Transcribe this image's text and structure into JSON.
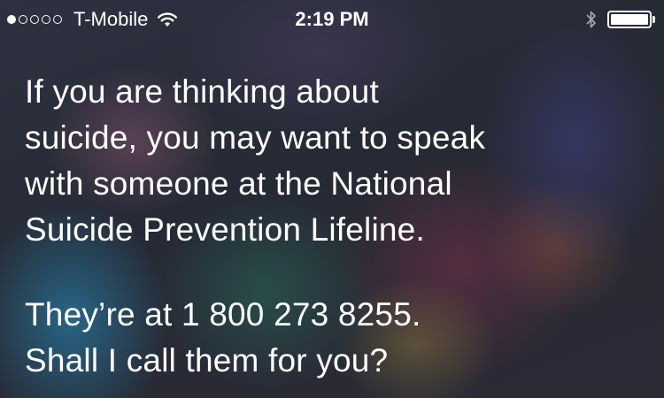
{
  "status_bar": {
    "carrier": "T-Mobile",
    "time": "2:19 PM",
    "signal_bars_filled": 1,
    "signal_bars_total": 5,
    "battery_level": 1.0
  },
  "siri_response": {
    "paragraph1_lines": [
      "If you are thinking about",
      "suicide, you may want to speak",
      "with someone at the National",
      "Suicide Prevention Lifeline."
    ],
    "paragraph2_lines": [
      "They’re at 1 800 273 8255.",
      "Shall I call them for you?"
    ]
  },
  "icons": [
    "signal-dots-icon",
    "wifi-icon",
    "bluetooth-icon",
    "battery-icon"
  ],
  "colors": {
    "text": "#ffffff"
  }
}
